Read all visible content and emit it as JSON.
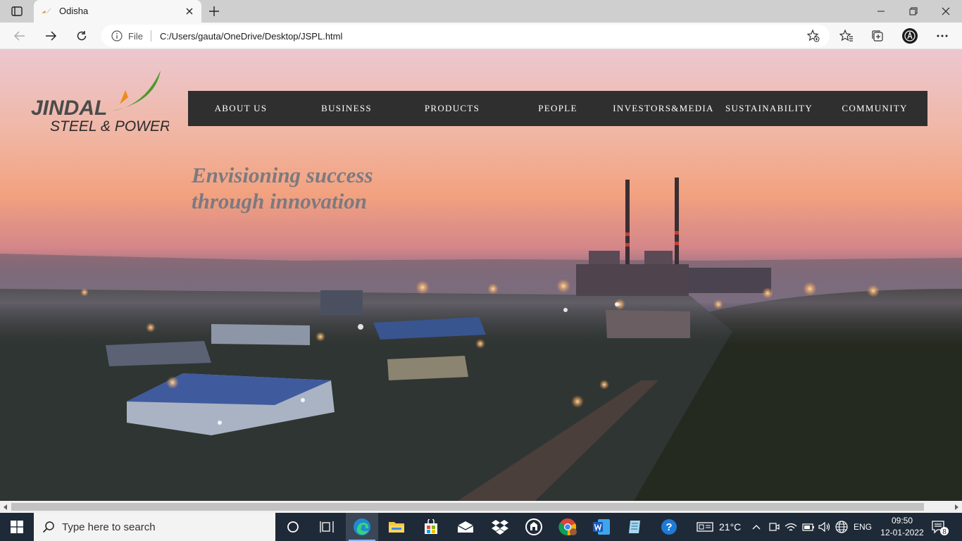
{
  "browser": {
    "tab_title": "Odisha",
    "address_scheme": "File",
    "address_url": "C:/Users/gauta/OneDrive/Desktop/JSPL.html"
  },
  "site": {
    "logo_line1": "JINDAL",
    "logo_line2": "STEEL & POWER",
    "menu": [
      "ABOUT US",
      "BUSINESS",
      "PRODUCTS",
      "PEOPLE",
      "INVESTORS&MEDIA",
      "SUSTAINABILITY",
      "COMMUNITY"
    ],
    "tagline_line1": "Envisioning success",
    "tagline_line2": "through innovation"
  },
  "taskbar": {
    "search_placeholder": "Type here to search",
    "weather": "21°C",
    "language": "ENG",
    "time": "09:50",
    "date": "12-01-2022",
    "notification_count": "8"
  },
  "colors": {
    "menu_bg": "#2f2f2f",
    "logo_green": "#4a9a2e",
    "logo_orange": "#f08a1c",
    "tagline": "#7c7a80",
    "taskbar_bg": "#1f2a38"
  }
}
